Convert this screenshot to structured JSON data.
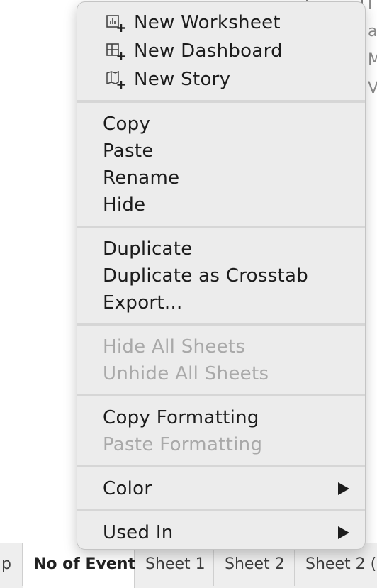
{
  "background": {
    "right_fragments": [
      "l",
      "a",
      "M",
      "V"
    ],
    "tabs": [
      {
        "label": "p",
        "active": false
      },
      {
        "label": "No of Event",
        "active": true
      },
      {
        "label": "Sheet 1",
        "active": false
      },
      {
        "label": "Sheet 2",
        "active": false
      },
      {
        "label": "Sheet 2 (",
        "active": false
      }
    ]
  },
  "menu": {
    "new_worksheet": {
      "label": "New Worksheet",
      "icon": "new-worksheet-icon"
    },
    "new_dashboard": {
      "label": "New Dashboard",
      "icon": "new-dashboard-icon"
    },
    "new_story": {
      "label": "New Story",
      "icon": "new-story-icon"
    },
    "copy": "Copy",
    "paste": "Paste",
    "rename": "Rename",
    "hide": "Hide",
    "duplicate": "Duplicate",
    "duplicate_crosstab": "Duplicate as Crosstab",
    "export": "Export...",
    "hide_all_sheets": "Hide All Sheets",
    "unhide_all_sheets": "Unhide All Sheets",
    "copy_formatting": "Copy Formatting",
    "paste_formatting": "Paste Formatting",
    "color": {
      "label": "Color",
      "icon": "submenu-arrow-icon"
    },
    "used_in": {
      "label": "Used In",
      "icon": "submenu-arrow-icon"
    }
  },
  "colors": {
    "menu_bg": "#ececec",
    "text": "#1c1c1c",
    "disabled_text": "#a9a9a9",
    "separator": "#d6d6d6"
  }
}
